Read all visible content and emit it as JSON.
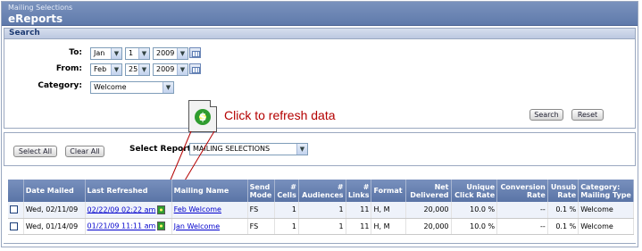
{
  "header": {
    "subtitle": "Mailing Selections",
    "title": "eReports"
  },
  "search": {
    "section_title": "Search",
    "to_label": "To:",
    "to_month": "Jan",
    "to_day": "1",
    "to_year": "2009",
    "from_label": "From:",
    "from_month": "Feb",
    "from_day": "25",
    "from_year": "2009",
    "category_label": "Category:",
    "category_value": "Welcome",
    "search_button": "Search",
    "reset_button": "Reset"
  },
  "callout": {
    "text": "Click to refresh data"
  },
  "filter": {
    "select_all": "Select All",
    "clear_all": "Clear All",
    "report_label": "Select Report:",
    "report_value": "MAILING SELECTIONS"
  },
  "table": {
    "headers": {
      "date_mailed": "Date Mailed",
      "last_refreshed": "Last Refreshed",
      "mailing_name": "Mailing Name",
      "send_mode": "Send Mode",
      "cells": "# Cells",
      "audiences": "# Audiences",
      "links": "# Links",
      "format": "Format",
      "net_delivered": "Net Delivered",
      "unique_click_rate": "Unique Click Rate",
      "conversion_rate": "Conversion Rate",
      "unsub_rate": "Unsub Rate",
      "category": "Category: Mailing Type"
    },
    "rows": [
      {
        "date_mailed": "Wed, 02/11/09",
        "last_refreshed": "02/22/09 02:22 am",
        "mailing_name": "Feb Welcome",
        "send_mode": "FS",
        "cells": "1",
        "audiences": "1",
        "links": "11",
        "format": "H, M",
        "net_delivered": "20,000",
        "unique_click_rate": "10.0 %",
        "conversion_rate": "--",
        "unsub_rate": "0.1 %",
        "category": "Welcome"
      },
      {
        "date_mailed": "Wed, 01/14/09",
        "last_refreshed": "01/21/09 11:11 am",
        "mailing_name": "Jan Welcome",
        "send_mode": "FS",
        "cells": "1",
        "audiences": "1",
        "links": "11",
        "format": "H, M",
        "net_delivered": "20,000",
        "unique_click_rate": "10.0 %",
        "conversion_rate": "--",
        "unsub_rate": "0.1 %",
        "category": "Welcome"
      }
    ]
  }
}
